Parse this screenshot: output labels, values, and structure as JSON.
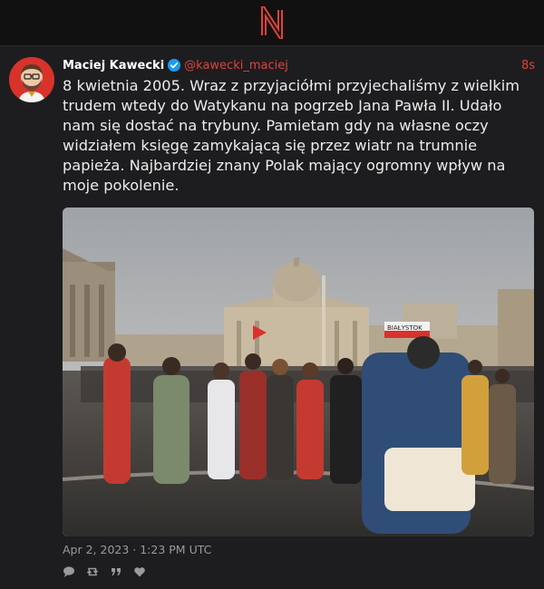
{
  "app": {
    "logo": "N"
  },
  "post": {
    "author_name": "Maciej Kawecki",
    "handle": "@kawecki_maciej",
    "time_ago": "8s",
    "text": "8 kwietnia 2005. Wraz z przyjaciółmi przyjechaliśmy z wielkim trudem wtedy do Watykanu na pogrzeb Jana Pawła II. Udało nam się dostać na trybuny. Pamietam gdy na własne oczy widziałem księgę zamykającą się przez wiatr na trumnie papieża. Najbardziej znany Polak mający ogromny wpływ na moje pokolenie.",
    "photo_banner_text": "BIAŁYSTOK",
    "date": "Apr 2, 2023 · 1:23 PM UTC",
    "verified": true
  },
  "actions": [
    {
      "icon": "reply-icon"
    },
    {
      "icon": "repost-icon"
    },
    {
      "icon": "quote-icon"
    },
    {
      "icon": "like-icon"
    }
  ],
  "colors": {
    "accent": "#e0423a",
    "background": "#1d1d1f",
    "topbar": "#111112",
    "verified": "#1d9bf0"
  }
}
